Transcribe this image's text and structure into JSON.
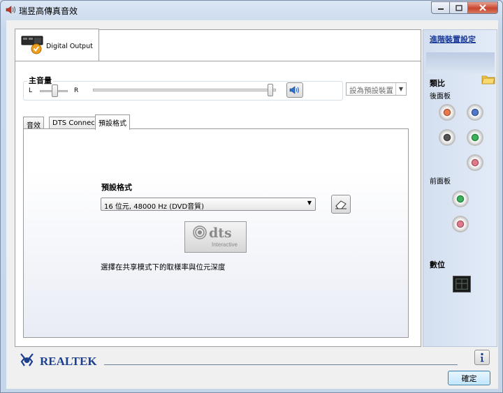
{
  "window": {
    "title": "瑞昱高傳真音效",
    "title_icon": "speaker-icon",
    "controls": [
      "minimize",
      "maximize",
      "close"
    ]
  },
  "device_tab": {
    "label": "Digital Output",
    "icon": "digital-output-device-icon"
  },
  "volume": {
    "title": "主音量",
    "left_label": "L",
    "right_label": "R",
    "balance": 0.5,
    "level": 1.0,
    "mute_icon": "speaker-volume-icon"
  },
  "default_device": {
    "label": "設為預設裝置"
  },
  "tabs": [
    {
      "label": "音效",
      "active": false
    },
    {
      "label": "DTS Connect",
      "active": false
    },
    {
      "label": "預設格式",
      "active": true
    }
  ],
  "format": {
    "heading": "預設格式",
    "selected": "16 位元, 48000 Hz (DVD音質)",
    "reset_icon": "eraser-icon",
    "dts_logo_text": "dts",
    "dts_logo_sub": "Interactive",
    "description": "選擇在共享模式下的取樣率與位元深度"
  },
  "side_panel": {
    "advanced_link": "進階裝置設定",
    "analog_heading": "類比",
    "rear_panel": "後面板",
    "front_panel": "前面板",
    "digital_heading": "數位",
    "rear_jacks": [
      "#e87a50",
      "#5078c8",
      "#555555",
      "#3cb05a",
      "#e07a8c"
    ],
    "front_jacks": [
      "#3cb05a",
      "#e07a8c"
    ],
    "folder_icon": "folder-icon",
    "digital_port_icon": "digital-port-icon"
  },
  "footer": {
    "brand": "REALTEK",
    "info_icon": "info-icon",
    "ok_label": "確定"
  },
  "colors": {
    "link": "#1a3a9a",
    "ok_border": "#3c7fb1"
  }
}
